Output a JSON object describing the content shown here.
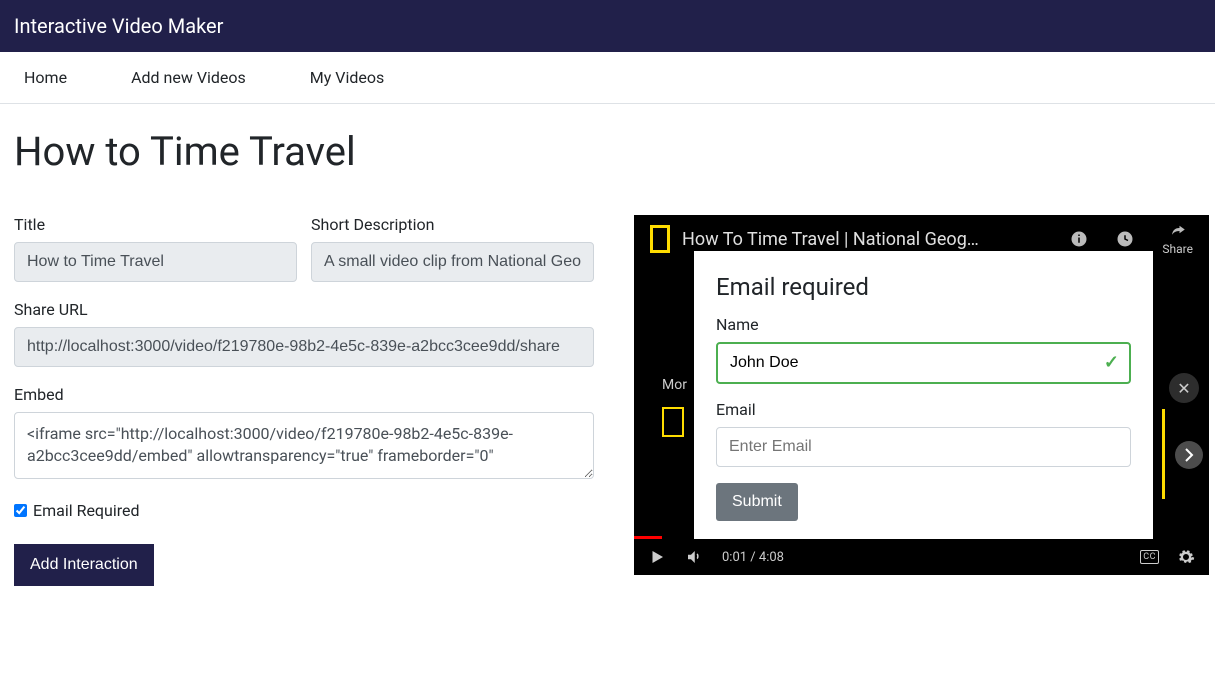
{
  "header": {
    "brand": "Interactive Video Maker"
  },
  "nav": {
    "items": [
      {
        "label": "Home"
      },
      {
        "label": "Add new Videos"
      },
      {
        "label": "My Videos"
      }
    ]
  },
  "page": {
    "title": "How to Time Travel"
  },
  "form": {
    "title_label": "Title",
    "title_value": "How to Time Travel",
    "desc_label": "Short Description",
    "desc_value": "A small video clip from National Geo",
    "share_label": "Share URL",
    "share_value": "http://localhost:3000/video/f219780e-98b2-4e5c-839e-a2bcc3cee9dd/share",
    "embed_label": "Embed",
    "embed_value": "<iframe src=\"http://localhost:3000/video/f219780e-98b2-4e5c-839e-a2bcc3cee9dd/embed\" allowtransparency=\"true\" frameborder=\"0\" ",
    "email_required_label": "Email Required",
    "email_required_checked": true,
    "add_interaction_label": "Add Interaction"
  },
  "video": {
    "title": "How To Time Travel | National Geog…",
    "share_label": "Share",
    "more_label": "Mor",
    "time_current": "0:01",
    "time_total": "4:08",
    "cc": "CC"
  },
  "modal": {
    "heading": "Email required",
    "name_label": "Name",
    "name_value": "John Doe",
    "email_label": "Email",
    "email_placeholder": "Enter Email",
    "submit_label": "Submit"
  }
}
